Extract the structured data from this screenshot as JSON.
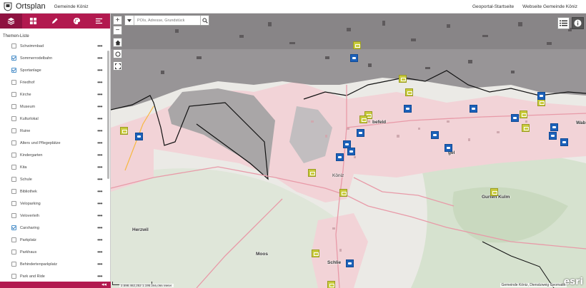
{
  "header": {
    "title": "Ortsplan",
    "org": "Gemeinde Köniz",
    "links": [
      "Geoportal-Startseite",
      "Webseite Gemeinde Köniz"
    ]
  },
  "sidebar": {
    "tools": [
      "layers-icon",
      "grid-icon",
      "pen-icon",
      "palette-icon",
      "menu-icon"
    ],
    "list_title": "Themen-Liste",
    "items": [
      {
        "label": "Schwimmbad",
        "checked": false
      },
      {
        "label": "Sommerrodelbahn",
        "checked": true
      },
      {
        "label": "Sportanlage",
        "checked": true
      },
      {
        "label": "Friedhof",
        "checked": false
      },
      {
        "label": "Kirche",
        "checked": false
      },
      {
        "label": "Museum",
        "checked": false
      },
      {
        "label": "Kulturlokal",
        "checked": false
      },
      {
        "label": "Ruine",
        "checked": false
      },
      {
        "label": "Alters und Pflegeplätze",
        "checked": false
      },
      {
        "label": "Kindergarten",
        "checked": false
      },
      {
        "label": "Kita",
        "checked": false
      },
      {
        "label": "Schule",
        "checked": false
      },
      {
        "label": "Bibliothek",
        "checked": false
      },
      {
        "label": "Veloparking",
        "checked": false
      },
      {
        "label": "Veloverleih",
        "checked": false
      },
      {
        "label": "Carsharing",
        "checked": true
      },
      {
        "label": "Parkplatz",
        "checked": false
      },
      {
        "label": "Parkhaus",
        "checked": false
      },
      {
        "label": "Behindertenparkplatz",
        "checked": false
      },
      {
        "label": "Park and Ride",
        "checked": false
      }
    ],
    "more_glyph": "•••",
    "collapse_glyph": "◂◂"
  },
  "map": {
    "search_placeholder": "POIs, Adresse, Grundstück",
    "zoom_in": "+",
    "zoom_out": "−",
    "places": [
      {
        "name": "Köniz",
        "bold": false
      },
      {
        "name": "Gurten Kulm",
        "bold": true
      },
      {
        "name": "Herzwil",
        "bold": true
      },
      {
        "name": "Moos",
        "bold": true
      },
      {
        "name": "Schlie",
        "bold": true
      },
      {
        "name": "Wab",
        "bold": true
      },
      {
        "name": "befeld",
        "bold": true
      },
      {
        "name": "gel",
        "bold": true
      }
    ],
    "coordinates": "2.598.462,252 1.195.266,066 Meter",
    "attribution": "Gemeinde Köniz, Dienstzweig Geomatik",
    "esri": "esri"
  }
}
